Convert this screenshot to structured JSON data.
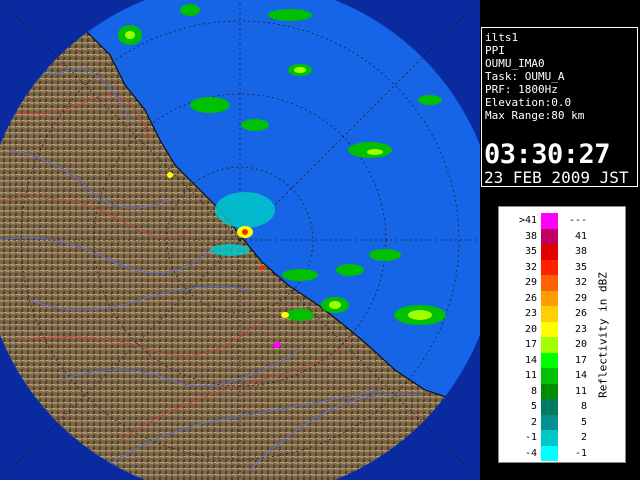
{
  "info": {
    "lines": [
      "ilts1",
      "PPI",
      "OUMU_IMA0",
      "Task: OUMU_A",
      "PRF: 1800Hz",
      "Elevation:0.0",
      "Max Range:80 km"
    ],
    "time": "03:30:27",
    "date": "23 FEB 2009 JST"
  },
  "legend": {
    "unit": "Reflectivity in dBZ",
    "rows": [
      {
        "lo": ">41",
        "hi": "---",
        "color": "#ff00ff"
      },
      {
        "lo": "38",
        "hi": "41",
        "color": "#c00060"
      },
      {
        "lo": "35",
        "hi": "38",
        "color": "#e00000"
      },
      {
        "lo": "32",
        "hi": "35",
        "color": "#ff2000"
      },
      {
        "lo": "29",
        "hi": "32",
        "color": "#ff6000"
      },
      {
        "lo": "26",
        "hi": "29",
        "color": "#ff9c00"
      },
      {
        "lo": "23",
        "hi": "26",
        "color": "#ffd000"
      },
      {
        "lo": "20",
        "hi": "23",
        "color": "#ffff00"
      },
      {
        "lo": "17",
        "hi": "20",
        "color": "#a0ff00"
      },
      {
        "lo": "14",
        "hi": "17",
        "color": "#00ff00"
      },
      {
        "lo": "11",
        "hi": "14",
        "color": "#00c000"
      },
      {
        "lo": "8",
        "hi": "11",
        "color": "#008c00"
      },
      {
        "lo": "5",
        "hi": "8",
        "color": "#007c60"
      },
      {
        "lo": "2",
        "hi": "5",
        "color": "#009090"
      },
      {
        "lo": "-1",
        "hi": "2",
        "color": "#00c8c8"
      },
      {
        "lo": "-4",
        "hi": "-1",
        "color": "#00ffff"
      }
    ]
  },
  "map": {
    "sea_color": "#1565e6",
    "land_color": "#7a6548",
    "out_of_range_color": "#0a2aa0"
  }
}
